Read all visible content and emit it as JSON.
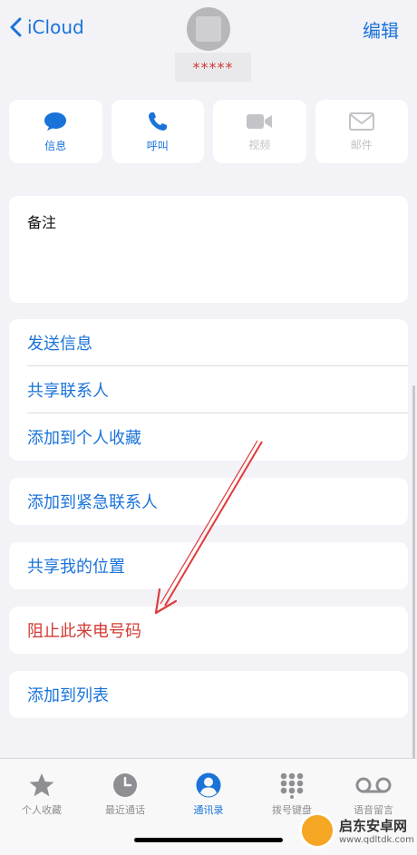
{
  "nav": {
    "back_label": "iCloud",
    "edit_label": "编辑",
    "contact_name": "*****"
  },
  "actions": [
    {
      "label": "信息",
      "icon": "message-icon",
      "enabled": true
    },
    {
      "label": "呼叫",
      "icon": "phone-icon",
      "enabled": true
    },
    {
      "label": "视频",
      "icon": "video-icon",
      "enabled": false
    },
    {
      "label": "邮件",
      "icon": "mail-icon",
      "enabled": false
    }
  ],
  "notes": {
    "label": "备注"
  },
  "menu": {
    "send_message": "发送信息",
    "share_contact": "共享联系人",
    "add_favorites": "添加到个人收藏",
    "add_emergency": "添加到紧急联系人",
    "share_location": "共享我的位置",
    "block_caller": "阻止此来电号码",
    "add_to_list": "添加到列表"
  },
  "tabs": [
    {
      "label": "个人收藏",
      "icon": "star-icon"
    },
    {
      "label": "最近通话",
      "icon": "clock-icon"
    },
    {
      "label": "通讯录",
      "icon": "person-icon",
      "active": true
    },
    {
      "label": "拨号键盘",
      "icon": "keypad-icon"
    },
    {
      "label": "语音留言",
      "icon": "voicemail-icon"
    }
  ],
  "watermark": {
    "title": "启东安卓网",
    "url": "www.qdltdk.com"
  },
  "colors": {
    "accent": "#1a73d9",
    "destructive": "#d23a32",
    "background": "#f2f2f7"
  }
}
